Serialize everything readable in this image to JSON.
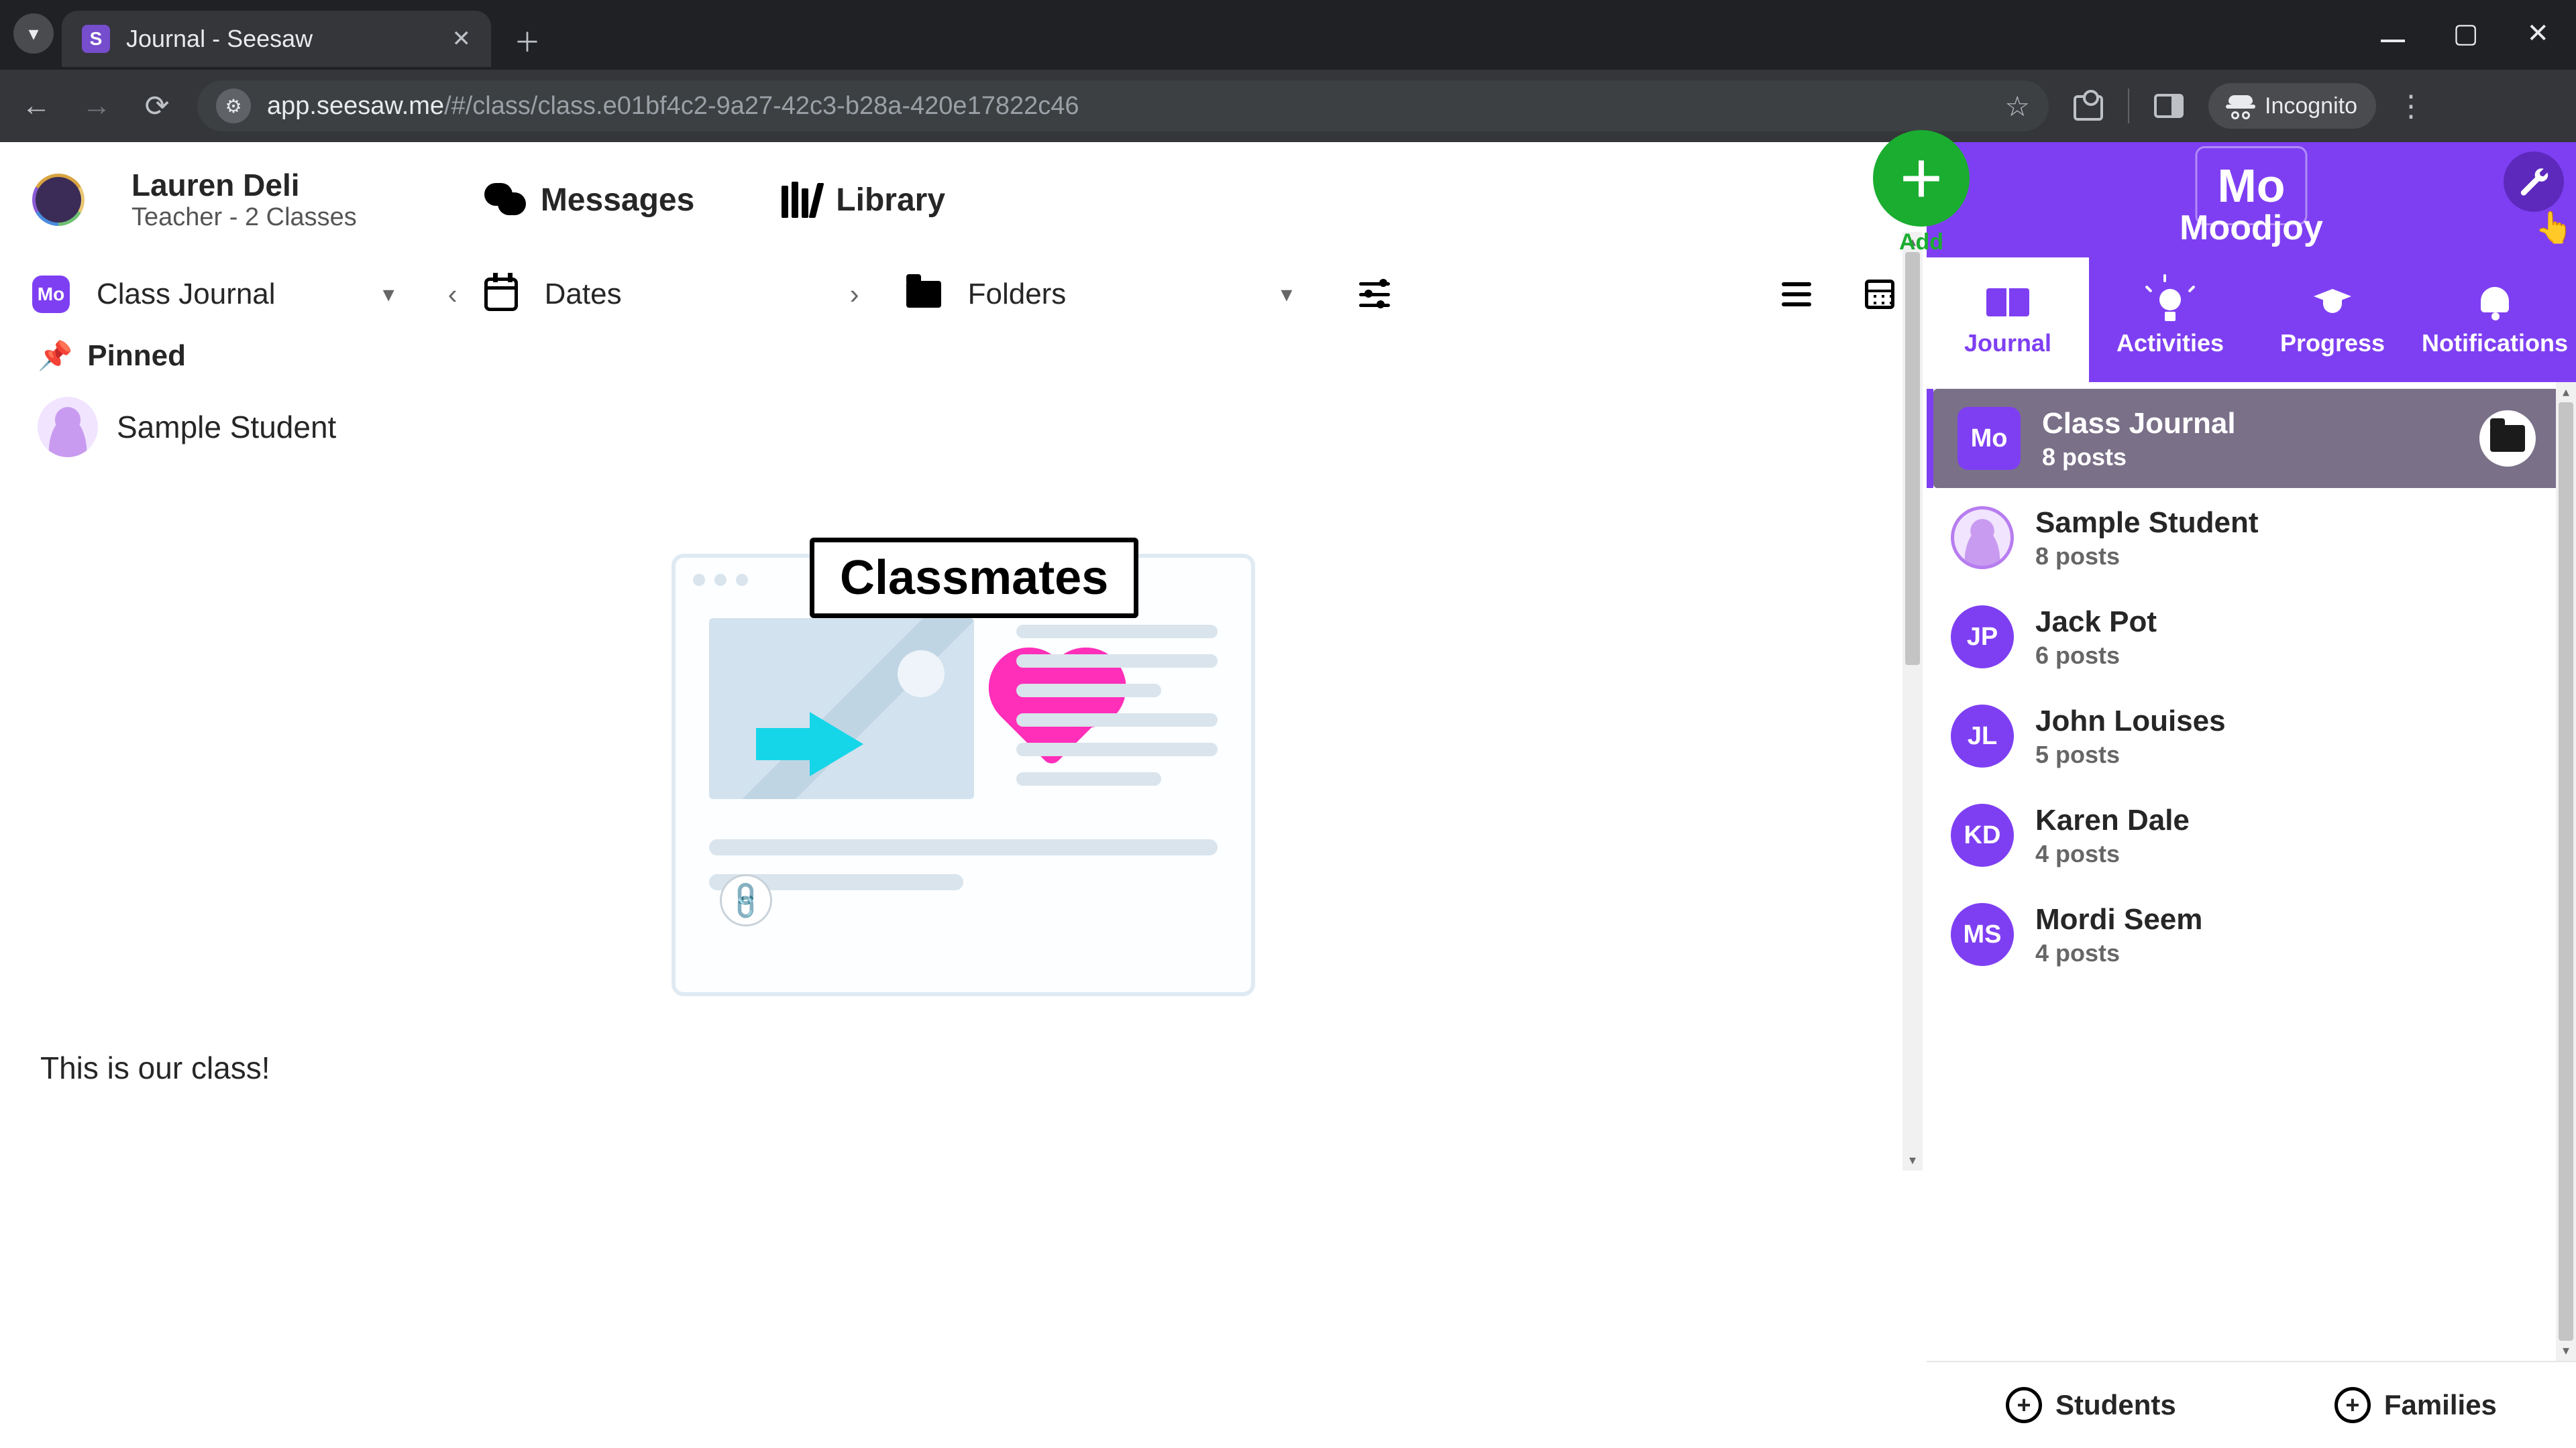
{
  "browser": {
    "tab_title": "Journal - Seesaw",
    "url_host": "app.seesaw.me",
    "url_path": "/#/class/class.e01bf4c2-9a27-42c3-b28a-420e17822c46",
    "incognito_label": "Incognito"
  },
  "header": {
    "teacher_name": "Lauren Deli",
    "teacher_role": "Teacher - 2 Classes",
    "messages_label": "Messages",
    "library_label": "Library"
  },
  "filters": {
    "class_journal_label": "Class Journal",
    "class_chip": "Mo",
    "dates_label": "Dates",
    "folders_label": "Folders"
  },
  "pinned": {
    "label": "Pinned",
    "student": "Sample Student"
  },
  "post": {
    "badge": "Classmates",
    "caption": "This is our class!"
  },
  "panel": {
    "class_code": "Mo",
    "class_name": "Moodjoy",
    "add_label": "Add",
    "tabs": {
      "journal": "Journal",
      "activities": "Activities",
      "progress": "Progress",
      "notifications": "Notifications"
    },
    "items": [
      {
        "avatar_text": "Mo",
        "avatar_kind": "square",
        "name": "Class Journal",
        "meta": "8 posts",
        "selected": true,
        "has_folder": true
      },
      {
        "avatar_text": "",
        "avatar_kind": "photo",
        "name": "Sample Student",
        "meta": "8 posts"
      },
      {
        "avatar_text": "JP",
        "avatar_kind": "circle",
        "name": "Jack Pot",
        "meta": "6 posts"
      },
      {
        "avatar_text": "JL",
        "avatar_kind": "circle",
        "name": "John Louises",
        "meta": "5 posts"
      },
      {
        "avatar_text": "KD",
        "avatar_kind": "circle",
        "name": "Karen Dale",
        "meta": "4 posts"
      },
      {
        "avatar_text": "MS",
        "avatar_kind": "circle",
        "name": "Mordi Seem",
        "meta": "4 posts"
      }
    ],
    "footer": {
      "students": "Students",
      "families": "Families"
    }
  },
  "colors": {
    "purple": "#7e3ff2",
    "green": "#1aad30"
  }
}
